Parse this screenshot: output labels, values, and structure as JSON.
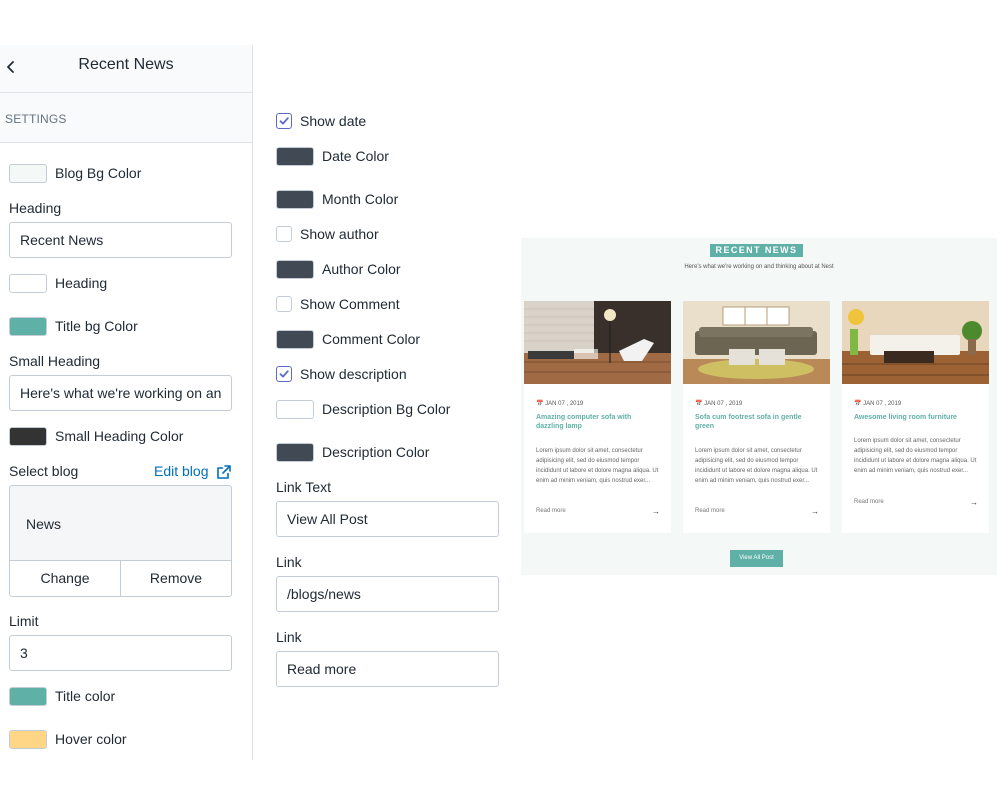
{
  "sidebar": {
    "title": "Recent News",
    "section_label": "SETTINGS",
    "blog_bg_color": {
      "label": "Blog Bg Color",
      "color": "#f4f8f7"
    },
    "heading": {
      "label": "Heading",
      "value": "Recent News"
    },
    "heading_color": {
      "label": "Heading",
      "color": "#ffffff"
    },
    "title_bg_color": {
      "label": "Title bg Color",
      "color": "#5fb0a6"
    },
    "small_heading": {
      "label": "Small Heading",
      "value": "Here's what we're working on an"
    },
    "small_heading_color": {
      "label": "Small Heading Color",
      "color": "#333333"
    },
    "select_blog": {
      "label": "Select blog",
      "edit_label": "Edit blog",
      "selected": "News",
      "change_label": "Change",
      "remove_label": "Remove"
    },
    "limit": {
      "label": "Limit",
      "value": "3"
    },
    "title_color": {
      "label": "Title color",
      "color": "#5fb0a6"
    },
    "hover_color": {
      "label": "Hover color",
      "color": "#ffd686"
    }
  },
  "middle": {
    "show_date": {
      "label": "Show date",
      "checked": true
    },
    "date_color": {
      "label": "Date Color",
      "color": "#414954"
    },
    "month_color": {
      "label": "Month Color",
      "color": "#414954"
    },
    "show_author": {
      "label": "Show author",
      "checked": false
    },
    "author_color": {
      "label": "Author Color",
      "color": "#414954"
    },
    "show_comment": {
      "label": "Show Comment",
      "checked": false
    },
    "comment_color": {
      "label": "Comment Color",
      "color": "#414954"
    },
    "show_description": {
      "label": "Show description",
      "checked": true
    },
    "description_bg_color": {
      "label": "Description Bg Color",
      "color": "#ffffff"
    },
    "description_color": {
      "label": "Description Color",
      "color": "#414954"
    },
    "link_text": {
      "label": "Link Text",
      "value": "View All Post"
    },
    "link": {
      "label": "Link",
      "value": "/blogs/news"
    },
    "link2": {
      "label": "Link",
      "value": "Read more"
    }
  },
  "preview": {
    "title": "RECENT NEWS",
    "subtitle": "Here's what we're working on and thinking about at Nest",
    "button": "View All Post",
    "cards": [
      {
        "date": "JAN 07 , 2019",
        "title": "Amazing computer sofa with dazzling lamp",
        "desc": "Lorem ipsum dolor sit amet, consectetur adipisicing elit, sed do eiusmod tempor incididunt ut labore et dolore magna aliqua. Ut enim ad minim veniam, quis nostrud exer...",
        "more": "Read more",
        "arrow": "→"
      },
      {
        "date": "JAN 07 , 2019",
        "title": "Sofa cum footrest sofa in gentle green",
        "desc": "Lorem ipsum dolor sit amet, consectetur adipisicing elit, sed do eiusmod tempor incididunt ut labore et dolore magna aliqua. Ut enim ad minim veniam, quis nostrud exer...",
        "more": "Read more",
        "arrow": "→"
      },
      {
        "date": "JAN 07 , 2019",
        "title": "Awesome living room furniture",
        "desc": "Lorem ipsum dolor sit amet, consectetur adipisicing elit, sed do eiusmod tempor incididunt ut labore et dolore magna aliqua. Ut enim ad minim veniam, quis nostrud exer...",
        "more": "Read more",
        "arrow": "→"
      }
    ]
  }
}
